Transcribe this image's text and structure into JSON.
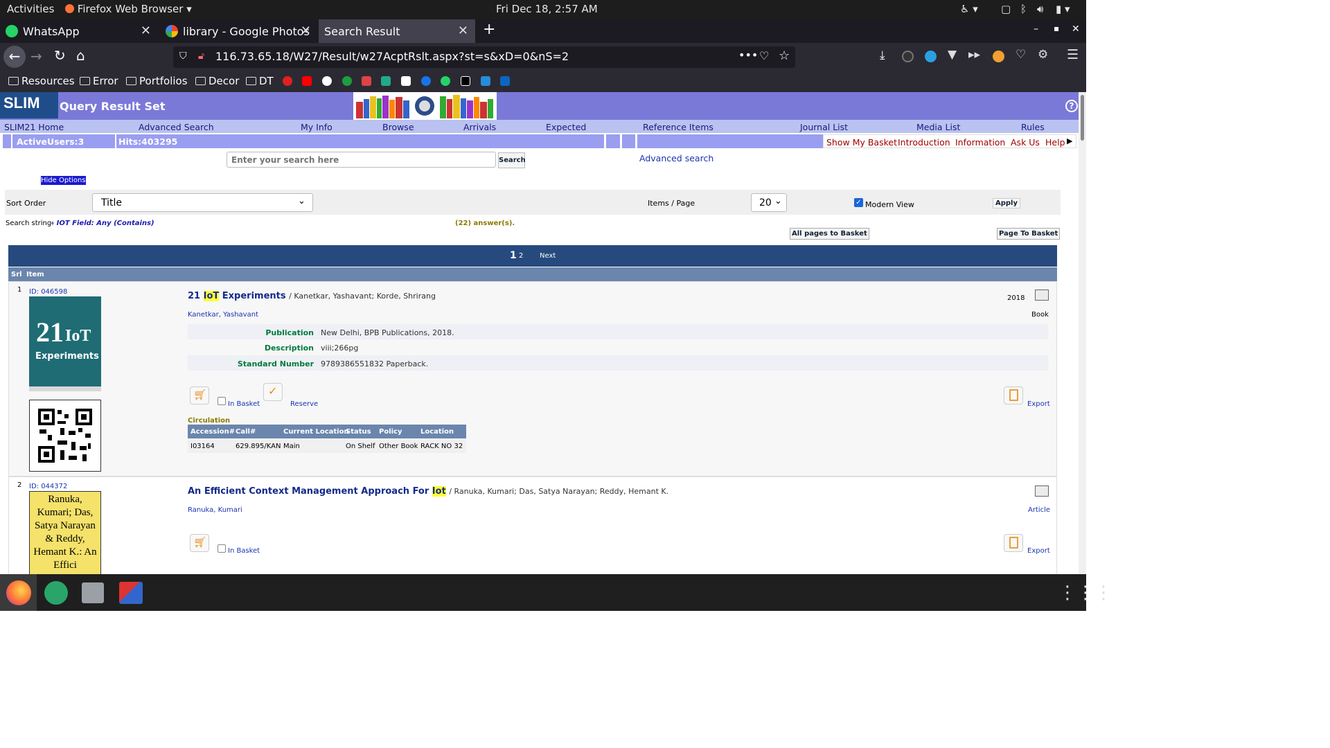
{
  "os": {
    "activities": "Activities",
    "app_name": "Firefox Web Browser",
    "clock": "Fri Dec 18,  2:57 AM"
  },
  "tabs": [
    {
      "label": "WhatsApp",
      "color": "#25d366"
    },
    {
      "label": "library - Google Photos",
      "color": "#fbbc04"
    },
    {
      "label": "Search Result",
      "color": ""
    }
  ],
  "url": "116.73.65.18/W27/Result/w27AcptRslt.aspx?st=s&xD=0&nS=2",
  "bookmarks": [
    "Resources",
    "Error",
    "Portfolios",
    "Decor",
    "DT"
  ],
  "header": {
    "logo": "SLIM",
    "title": "Query Result Set",
    "help": "?"
  },
  "menu": [
    "SLIM21 Home",
    "Advanced Search",
    "My Info",
    "Browse",
    "Arrivals",
    "Expected",
    "Reference Items",
    "Journal List",
    "Media List",
    "Rules"
  ],
  "status": {
    "active_users": "ActiveUsers:3",
    "hits": "Hits:403295"
  },
  "links": [
    "Show My Basket",
    "Introduction",
    "Information",
    "Ask Us",
    "Help"
  ],
  "search": {
    "placeholder": "Enter your search here",
    "button": "Search",
    "advanced": "Advanced search"
  },
  "options": {
    "hide": "Hide Options",
    "sort_label": "Sort Order",
    "sort_value": "Title",
    "items_label": "Items / Page",
    "items_value": "20",
    "modern": "Modern View",
    "apply": "Apply"
  },
  "query": {
    "prefix": "Search string:",
    "string": "- IOT Field: Any (Contains)",
    "answers": "(22) answer(s).",
    "all_pages": "All pages to Basket",
    "page_basket": "Page To Basket"
  },
  "pager": {
    "current": "1",
    "other": "2",
    "next": "Next"
  },
  "cols": {
    "srl": "Srl",
    "item": "Item"
  },
  "results": [
    {
      "srl": "1",
      "id": "ID:  046598",
      "title_pre": "21 ",
      "title_hl": "IoT",
      "title_post": " Experiments",
      "authors": "/ Kanetkar, Yashavant; Korde, Shrirang",
      "author_link": "Kanetkar, Yashavant",
      "year": "2018",
      "type": "Book",
      "fields": [
        {
          "label": "Publication",
          "value": "New Delhi, BPB Publications, 2018."
        },
        {
          "label": "Description",
          "value": "viii;266pg"
        },
        {
          "label": "Standard Number",
          "value": "9789386551832 Paperback."
        }
      ],
      "in_basket": "In Basket",
      "reserve": "Reserve",
      "export": "Export",
      "circulation": "Circulation",
      "circ_headers": [
        "Accession#",
        "Call#",
        "Current Location",
        "Status",
        "Policy",
        "Location"
      ],
      "circ_row": [
        "I03164",
        "629.895/KAN",
        "Main",
        "On Shelf",
        "Other Book",
        "RACK NO 32"
      ],
      "cover": {
        "big": "21",
        "sub": "IoT",
        "caption": "Experiments"
      }
    },
    {
      "srl": "2",
      "id": "ID:  044372",
      "title_pre": "An Efficient Context Management Approach For ",
      "title_hl": "Iot",
      "title_post": "",
      "authors": "/ Ranuka, Kumari; Das, Satya Narayan; Reddy, Hemant K.",
      "author_link": "Ranuka, Kumari",
      "type": "Article",
      "in_basket": "In Basket",
      "export": "Export",
      "cover_text": "Ranuka, Kumari; Das, Satya Narayan & Reddy, Hemant K.: An Effici"
    }
  ]
}
